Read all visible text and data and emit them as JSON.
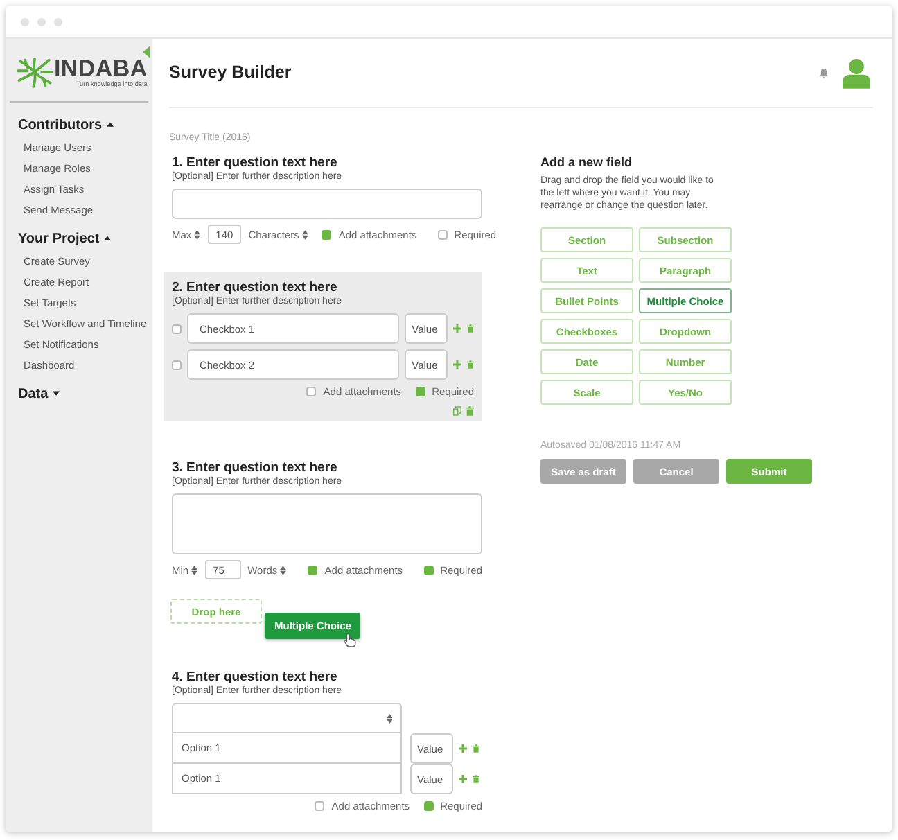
{
  "sidebar": {
    "logo": {
      "name": "INDABA",
      "tagline": "Turn knowledge into data"
    },
    "sections": [
      {
        "title": "Contributors",
        "expanded": true,
        "items": [
          "Manage Users",
          "Manage Roles",
          "Assign Tasks",
          "Send Message"
        ]
      },
      {
        "title": "Your Project",
        "expanded": true,
        "items": [
          "Create Survey",
          "Create Report",
          "Set Targets",
          "Set Workflow and Timeline",
          "Set Notifications",
          "Dashboard"
        ]
      },
      {
        "title": "Data",
        "expanded": false
      }
    ]
  },
  "header": {
    "title": "Survey Builder"
  },
  "survey_title": "Survey Title (2016)",
  "questions": [
    {
      "kind": "text",
      "selected": false,
      "title": "1. Enter question text here",
      "description": "[Optional] Enter further description here",
      "limit": {
        "label": "Max",
        "value": "140",
        "unit": "Characters"
      },
      "attachments": true,
      "attachments_label": "Add attachments",
      "required": false,
      "required_label": "Required"
    },
    {
      "kind": "checkboxes",
      "selected": true,
      "title": "2. Enter question text here",
      "description": "[Optional] Enter further description here",
      "options": [
        {
          "placeholder": "Checkbox 1",
          "value_placeholder": "Value",
          "checked": false
        },
        {
          "placeholder": "Checkbox 2",
          "value_placeholder": "Value",
          "checked": false
        }
      ],
      "attachments": false,
      "attachments_label": "Add attachments",
      "required": true,
      "required_label": "Required"
    },
    {
      "kind": "paragraph",
      "selected": false,
      "title": "3. Enter question text here",
      "description": "[Optional] Enter further description here",
      "limit": {
        "label": "Min",
        "value": "75",
        "unit": "Words"
      },
      "attachments": true,
      "attachments_label": "Add attachments",
      "required": true,
      "required_label": "Required"
    },
    {
      "kind": "dropdown",
      "selected": false,
      "title": "4. Enter question text here",
      "description": "[Optional] Enter further description here",
      "options": [
        {
          "placeholder": "Option 1",
          "value_placeholder": "Value"
        },
        {
          "placeholder": "Option 1",
          "value_placeholder": "Value"
        }
      ],
      "attachments": false,
      "attachments_label": "Add attachments",
      "required": true,
      "required_label": "Required"
    }
  ],
  "drop_zone": {
    "label": "Drop here",
    "dragged": "Multiple Choice"
  },
  "add_field": {
    "title": "Add a new field",
    "description": "Drag and drop the field you would like to the left where you want it. You may rearrange or change the question later.",
    "fields": [
      {
        "label": "Section",
        "selected": false
      },
      {
        "label": "Subsection",
        "selected": false
      },
      {
        "label": "Text",
        "selected": false
      },
      {
        "label": "Paragraph",
        "selected": false
      },
      {
        "label": "Bullet Points",
        "selected": false
      },
      {
        "label": "Multiple Choice",
        "selected": true
      },
      {
        "label": "Checkboxes",
        "selected": false
      },
      {
        "label": "Dropdown",
        "selected": false
      },
      {
        "label": "Date",
        "selected": false
      },
      {
        "label": "Number",
        "selected": false
      },
      {
        "label": "Scale",
        "selected": false
      },
      {
        "label": "Yes/No",
        "selected": false
      }
    ]
  },
  "autosave": "Autosaved 01/08/2016 11:47 AM",
  "actions": [
    {
      "label": "Save as draft",
      "kind": "secondary"
    },
    {
      "label": "Cancel",
      "kind": "secondary"
    },
    {
      "label": "Submit",
      "kind": "primary"
    }
  ]
}
